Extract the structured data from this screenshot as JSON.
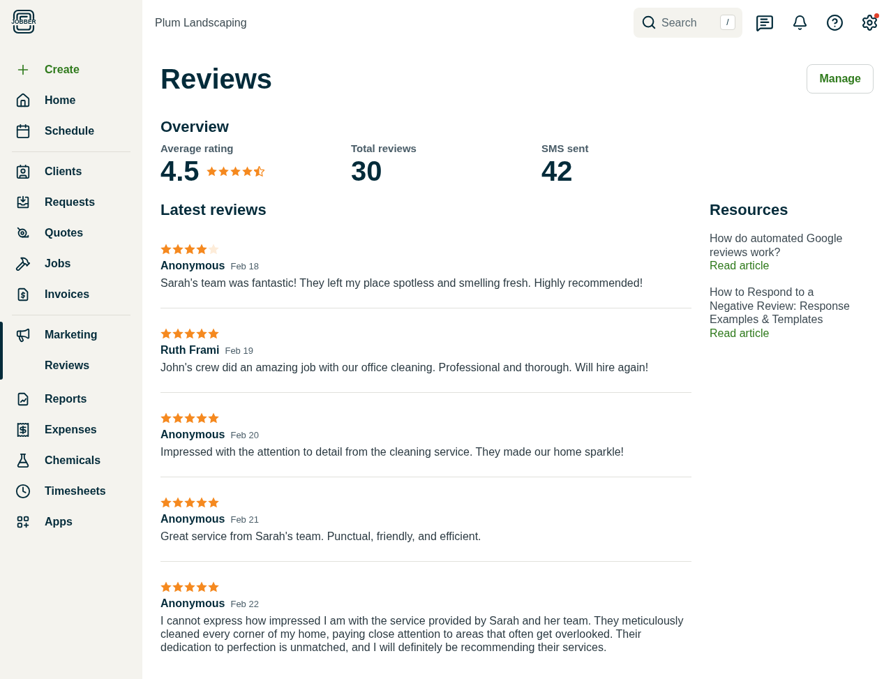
{
  "logo": {
    "text": "JOBBER"
  },
  "sidebar": {
    "sections": [
      {
        "items": [
          {
            "label": "Create",
            "kind": "create",
            "selected": false
          },
          {
            "label": "Home",
            "kind": "link",
            "selected": false
          },
          {
            "label": "Schedule",
            "kind": "link",
            "selected": false
          }
        ]
      },
      {
        "items": [
          {
            "label": "Clients",
            "kind": "link",
            "selected": false
          },
          {
            "label": "Requests",
            "kind": "link",
            "selected": false
          },
          {
            "label": "Quotes",
            "kind": "link",
            "selected": false
          },
          {
            "label": "Jobs",
            "kind": "link",
            "selected": false
          },
          {
            "label": "Invoices",
            "kind": "link",
            "selected": false
          }
        ]
      },
      {
        "items": [
          {
            "label": "Marketing",
            "kind": "link",
            "selected": true,
            "children": [
              {
                "label": "Reviews",
                "selected": true
              }
            ]
          },
          {
            "label": "Reports",
            "kind": "link",
            "selected": false
          },
          {
            "label": "Expenses",
            "kind": "link",
            "selected": false
          },
          {
            "label": "Chemicals",
            "kind": "link",
            "selected": false
          },
          {
            "label": "Timesheets",
            "kind": "link",
            "selected": false
          },
          {
            "label": "Apps",
            "kind": "link",
            "selected": false
          }
        ]
      }
    ]
  },
  "topbar": {
    "account": "Plum Landscaping",
    "search": {
      "placeholder": "Search",
      "shortcut": "/"
    },
    "settings_alert": true
  },
  "page": {
    "title": "Reviews",
    "action": "Manage"
  },
  "overview": {
    "title": "Overview",
    "stats": [
      {
        "label": "Average rating",
        "value": "4.5",
        "stars": 4.5
      },
      {
        "label": "Total reviews",
        "value": "30"
      },
      {
        "label": "SMS sent",
        "value": "42"
      }
    ]
  },
  "latest_reviews": {
    "title": "Latest reviews",
    "reviews": [
      {
        "stars": 4,
        "author": "Anonymous",
        "date": "Feb 18",
        "text": "Sarah's team was fantastic! They left my place spotless and smelling fresh. Highly recommended!"
      },
      {
        "stars": 5,
        "author": "Ruth Frami",
        "date": "Feb 19",
        "text": "John's crew did an amazing job with our office cleaning. Professional and thorough. Will hire again!"
      },
      {
        "stars": 5,
        "author": "Anonymous",
        "date": "Feb 20",
        "text": "Impressed with the attention to detail from the cleaning service. They made our home sparkle!"
      },
      {
        "stars": 5,
        "author": "Anonymous",
        "date": "Feb 21",
        "text": "Great service from Sarah's team. Punctual, friendly, and efficient."
      },
      {
        "stars": 5,
        "author": "Anonymous",
        "date": "Feb 22",
        "text": "I cannot express how impressed I am with the service provided by Sarah and her team. They meticulously cleaned every corner of my home, paying close attention to areas that often get overlooked. Their dedication to perfection is unmatched, and I will definitely be recommending their services."
      }
    ]
  },
  "resources": {
    "title": "Resources",
    "articles": [
      {
        "title": "How do automated Google reviews work?",
        "link": "Read article"
      },
      {
        "title": "How to Respond to a Negative Review: Response Examples & Templates",
        "link": "Read article"
      }
    ]
  }
}
